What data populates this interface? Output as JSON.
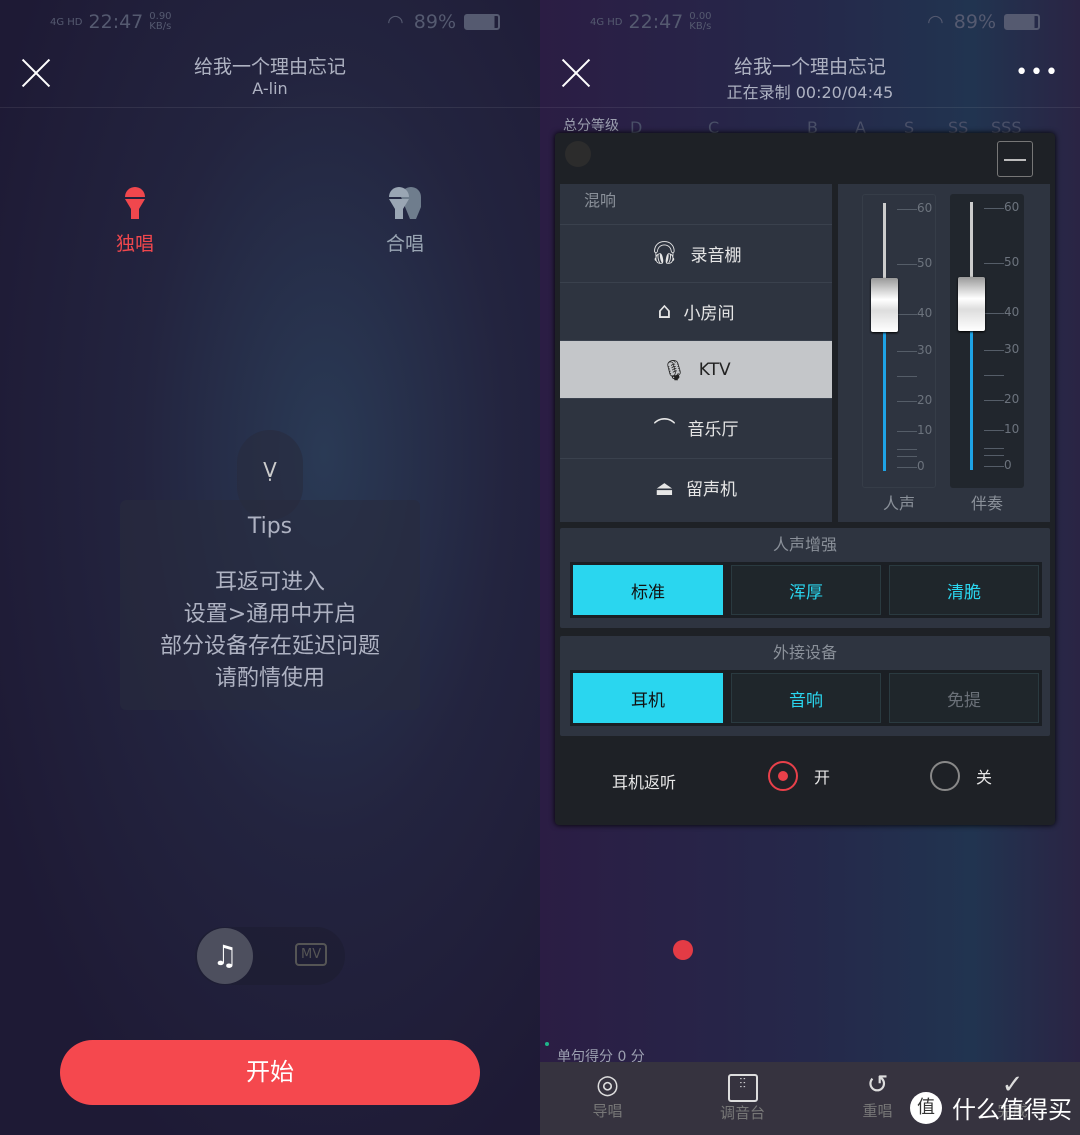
{
  "left": {
    "status": {
      "network": "4G HD",
      "time": "22:47",
      "speed": "0.90",
      "speed_unit": "KB/s",
      "battery": "89%",
      "battery_level": 89
    },
    "header": {
      "title": "给我一个理由忘记",
      "subtitle": "A-lin"
    },
    "modes": [
      {
        "label": "独唱",
        "icon": "microphone-icon",
        "active": true,
        "color": "#f0474d"
      },
      {
        "label": "合唱",
        "icon": "duet-microphone-icon",
        "active": false
      }
    ],
    "tips": {
      "title": "Tips",
      "lines": [
        "耳返可进入",
        "设置>通用中开启",
        "部分设备存在延迟问题",
        "请酌情使用"
      ]
    },
    "media_toggle": {
      "options": [
        "audio",
        "MV"
      ],
      "selected": "audio"
    },
    "start_label": "开始",
    "accent": "#f5484e"
  },
  "right": {
    "status": {
      "network": "4G HD",
      "time": "22:47",
      "speed": "0.00",
      "speed_unit": "KB/s",
      "battery": "89%",
      "battery_level": 89
    },
    "header": {
      "title": "给我一个理由忘记",
      "subtitle": "正在录制 00:20/04:45"
    },
    "grade": {
      "label": "总分等级",
      "levels": [
        "D",
        "C",
        "B",
        "A",
        "S",
        "SS",
        "SSS"
      ]
    },
    "reverb": {
      "title": "混响",
      "items": [
        {
          "label": "录音棚",
          "icon": "headphones-icon"
        },
        {
          "label": "小房间",
          "icon": "house-icon"
        },
        {
          "label": "KTV",
          "icon": "microphone-icon",
          "selected": true
        },
        {
          "label": "音乐厅",
          "icon": "concert-hall-icon"
        },
        {
          "label": "留声机",
          "icon": "gramophone-icon"
        }
      ]
    },
    "faders": {
      "scale": [
        "60",
        "50",
        "40",
        "30",
        "20",
        "10",
        "0"
      ],
      "vocal": {
        "label": "人声",
        "value": 42
      },
      "accompaniment": {
        "label": "伴奏",
        "value": 42
      }
    },
    "voice_enhance": {
      "title": "人声增强",
      "options": [
        "标准",
        "浑厚",
        "清脆"
      ],
      "selected": "标准"
    },
    "external_device": {
      "title": "外接设备",
      "options": [
        "耳机",
        "音响",
        "免提"
      ],
      "selected": "耳机"
    },
    "monitor": {
      "label": "耳机返听",
      "on": "开",
      "off": "关",
      "value": "开"
    },
    "score": "单句得分 0 分",
    "toolbar": [
      {
        "label": "导唱",
        "icon": "guide-vocal-icon"
      },
      {
        "label": "调音台",
        "icon": "mixer-icon"
      },
      {
        "label": "重唱",
        "icon": "redo-icon"
      },
      {
        "label": "完成",
        "icon": "check-icon"
      }
    ],
    "accent": "#2ad6ef"
  },
  "watermark": "什么值得买"
}
